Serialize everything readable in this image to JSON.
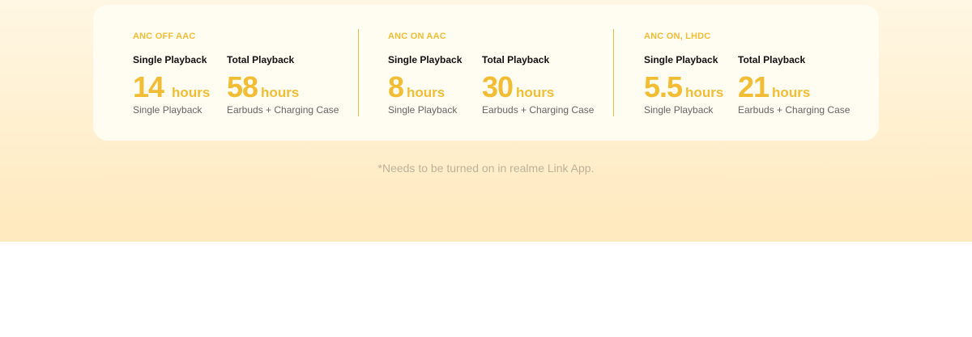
{
  "colors": {
    "accent": "#f2bd34",
    "divider": "#eab949",
    "footnote": "#bdb29a",
    "band_top": "#fff7e4",
    "band_bottom": "#ffe9bd",
    "card": "#fffcf1"
  },
  "groups": [
    {
      "title": "ANC OFF AAC",
      "single": {
        "label": "Single Playback",
        "value": "14",
        "unit": "hours",
        "sub": "Single Playback"
      },
      "total": {
        "label": "Total Playback",
        "value": "58",
        "unit": "hours",
        "sub": "Earbuds + Charging Case"
      }
    },
    {
      "title": "ANC ON AAC",
      "single": {
        "label": "Single Playback",
        "value": "8",
        "unit": "hours",
        "sub": "Single Playback"
      },
      "total": {
        "label": "Total Playback",
        "value": "30",
        "unit": "hours",
        "sub": "Earbuds + Charging Case"
      }
    },
    {
      "title": "ANC ON, LHDC",
      "single": {
        "label": "Single Playback",
        "value": "5.5",
        "unit": "hours",
        "sub": "Single Playback"
      },
      "total": {
        "label": "Total Playback",
        "value": "21",
        "unit": "hours",
        "sub": "Earbuds + Charging Case"
      }
    }
  ],
  "footnote": "*Needs to be turned on in realme Link App."
}
